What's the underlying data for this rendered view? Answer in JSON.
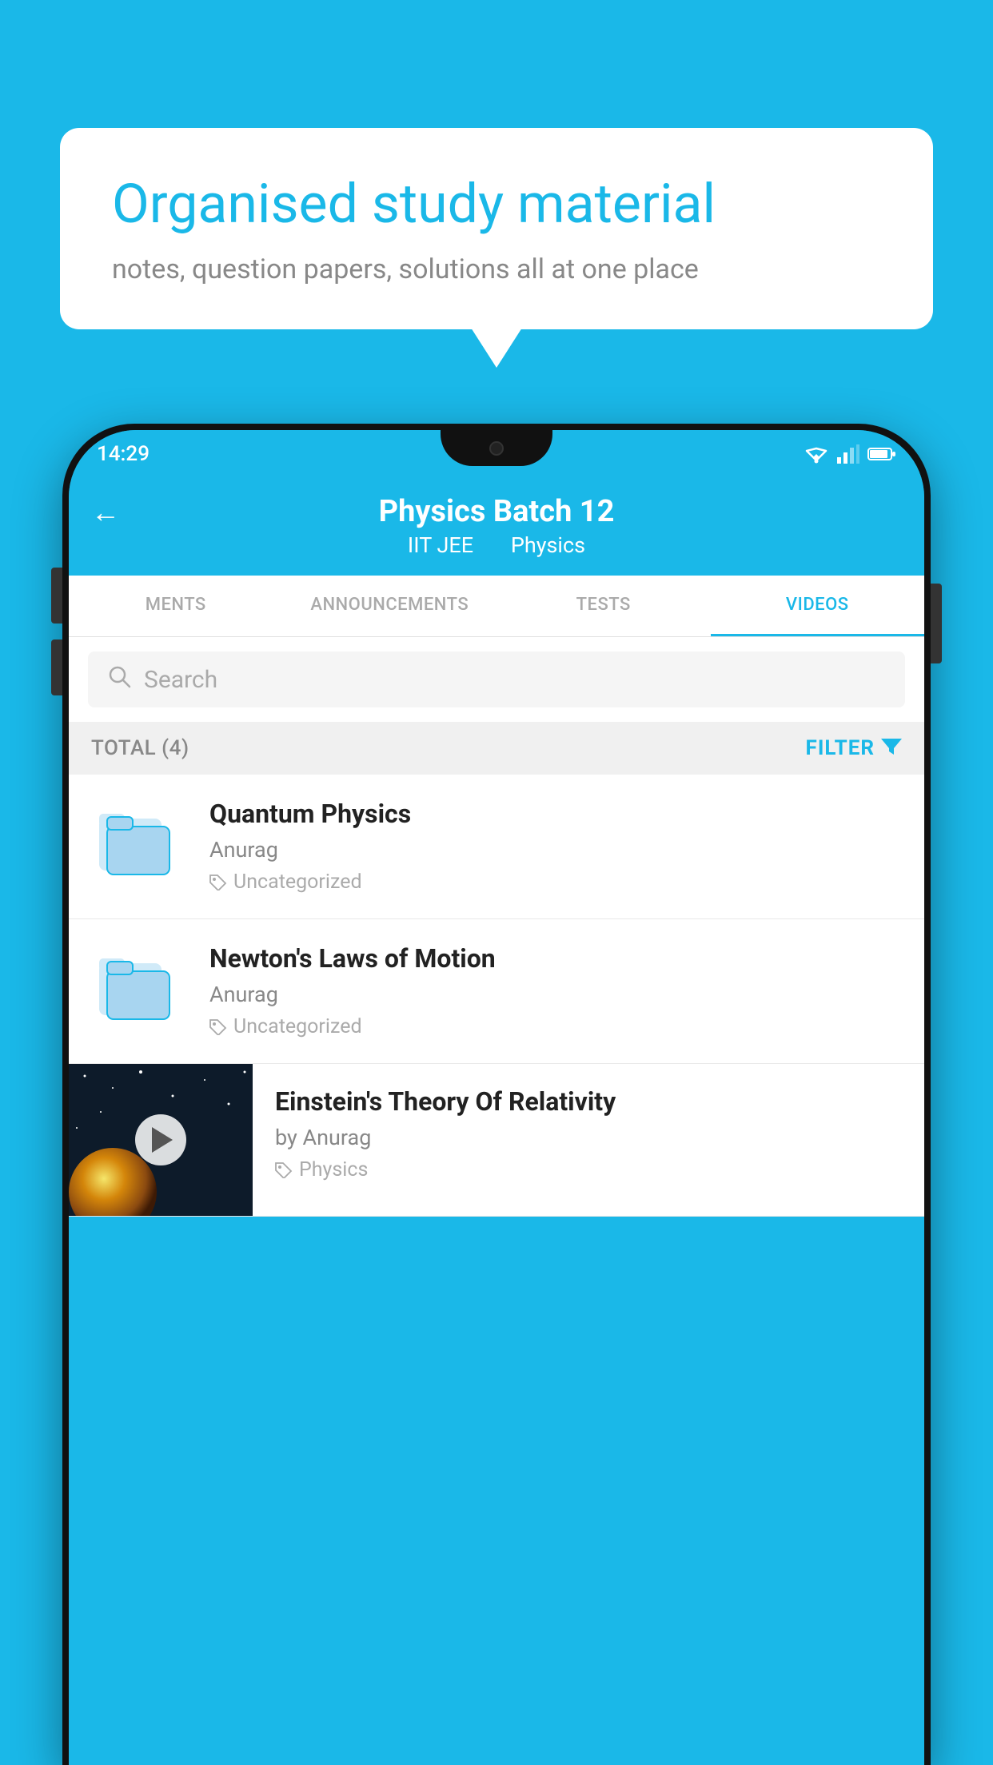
{
  "bubble": {
    "title": "Organised study material",
    "subtitle": "notes, question papers, solutions all at one place"
  },
  "status_bar": {
    "time": "14:29",
    "wifi_icon": "wifi",
    "signal_icon": "signal",
    "battery_icon": "battery"
  },
  "header": {
    "back_icon": "←",
    "title": "Physics Batch 12",
    "subtitle1": "IIT JEE",
    "subtitle2": "Physics"
  },
  "tabs": [
    {
      "label": "MENTS",
      "active": false
    },
    {
      "label": "ANNOUNCEMENTS",
      "active": false
    },
    {
      "label": "TESTS",
      "active": false
    },
    {
      "label": "VIDEOS",
      "active": true
    }
  ],
  "search": {
    "placeholder": "Search",
    "icon": "🔍"
  },
  "filter_bar": {
    "total_label": "TOTAL (4)",
    "filter_label": "FILTER",
    "filter_icon": "▼"
  },
  "videos": [
    {
      "id": 1,
      "title": "Quantum Physics",
      "author": "Anurag",
      "tag": "Uncategorized",
      "type": "folder"
    },
    {
      "id": 2,
      "title": "Newton's Laws of Motion",
      "author": "Anurag",
      "tag": "Uncategorized",
      "type": "folder"
    },
    {
      "id": 3,
      "title": "Einstein's Theory Of Relativity",
      "author": "by Anurag",
      "tag": "Physics",
      "type": "video"
    }
  ]
}
